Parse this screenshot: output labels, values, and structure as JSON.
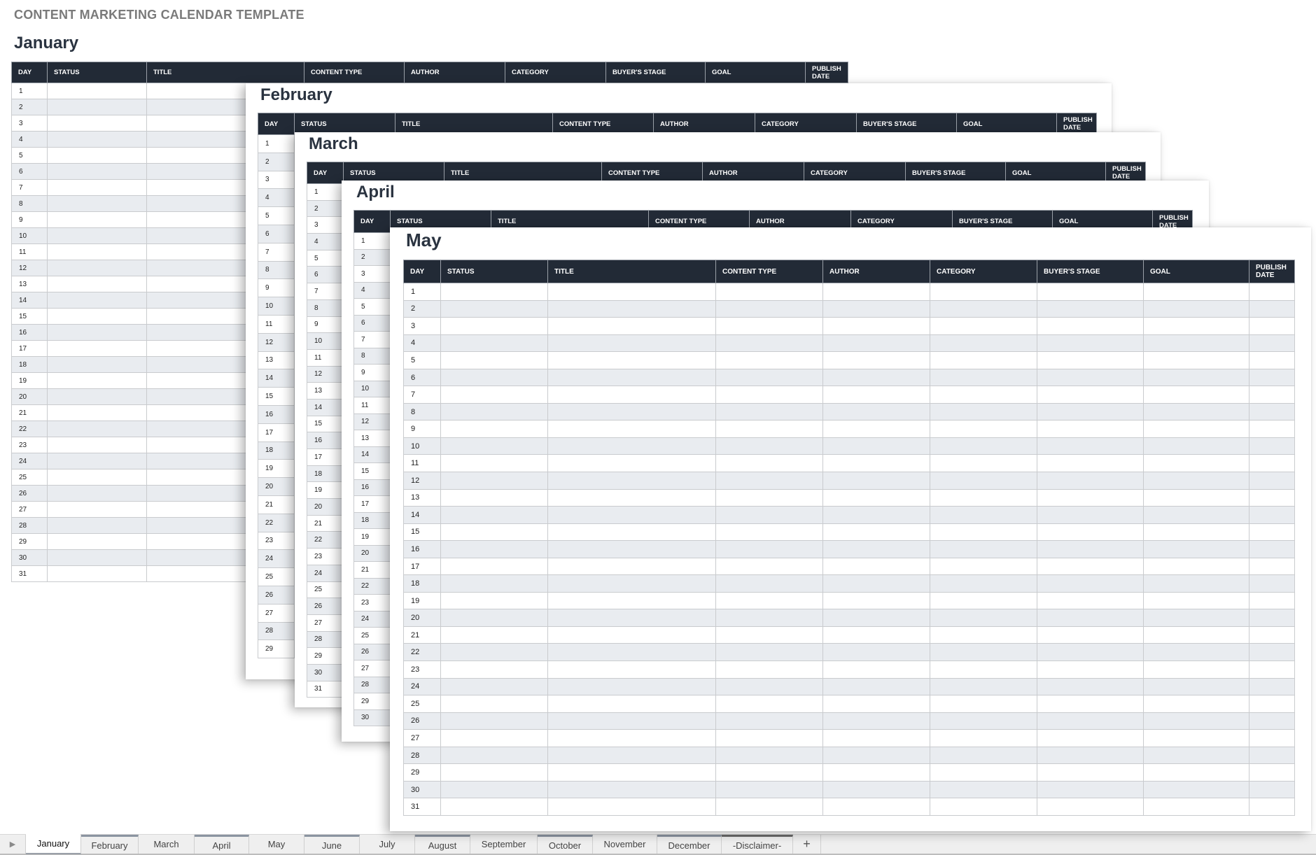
{
  "document": {
    "title": "CONTENT MARKETING CALENDAR TEMPLATE"
  },
  "columns": [
    "DAY",
    "STATUS",
    "TITLE",
    "CONTENT TYPE",
    "AUTHOR",
    "CATEGORY",
    "BUYER'S STAGE",
    "GOAL",
    "PUBLISH DATE"
  ],
  "sheets": [
    {
      "month": "January",
      "days": 31
    },
    {
      "month": "February",
      "days": 29
    },
    {
      "month": "March",
      "days": 31
    },
    {
      "month": "April",
      "days": 30
    },
    {
      "month": "May",
      "days": 31
    }
  ],
  "tabs": {
    "nav_icon": "play-triangle-icon",
    "items": [
      {
        "label": "January",
        "active": true
      },
      {
        "label": "February",
        "active": false
      },
      {
        "label": "March",
        "active": false
      },
      {
        "label": "April",
        "active": false
      },
      {
        "label": "May",
        "active": false
      },
      {
        "label": "June",
        "active": false
      },
      {
        "label": "July",
        "active": false
      },
      {
        "label": "August",
        "active": false
      },
      {
        "label": "September",
        "active": false
      },
      {
        "label": "October",
        "active": false
      },
      {
        "label": "November",
        "active": false
      },
      {
        "label": "December",
        "active": false
      },
      {
        "label": "-Disclaimer-",
        "active": false
      }
    ],
    "add_label": "+"
  },
  "colors": {
    "header_bg": "#222a36",
    "stripe": "#e9ecf0",
    "title_gray": "#7a7a7a"
  }
}
